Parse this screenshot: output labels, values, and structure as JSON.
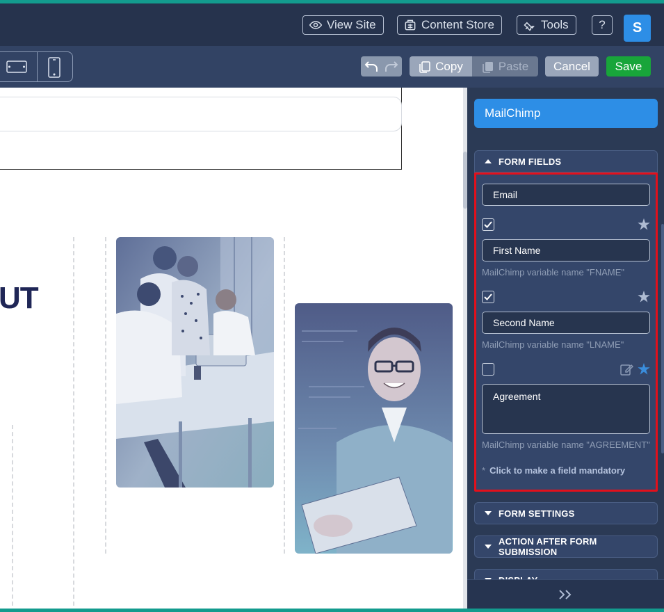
{
  "topbar": {
    "view_site": "View Site",
    "content_store": "Content Store",
    "tools": "Tools",
    "help": "?",
    "avatar_initial": "S"
  },
  "toolbar": {
    "copy": "Copy",
    "paste": "Paste",
    "cancel": "Cancel",
    "save": "Save"
  },
  "canvas": {
    "heading_fragment": "UT"
  },
  "panel": {
    "title": "MailChimp",
    "sections": {
      "form_fields": "FORM FIELDS",
      "form_settings": "FORM SETTINGS",
      "action_after": "ACTION AFTER FORM SUBMISSION",
      "display": "DISPLAY"
    },
    "fields": [
      {
        "label": "Email",
        "checked": null,
        "variable": ""
      },
      {
        "label": "First Name",
        "checked": true,
        "variable": "MailChimp variable name \"FNAME\""
      },
      {
        "label": "Second Name",
        "checked": true,
        "variable": "MailChimp variable name \"LNAME\""
      },
      {
        "label": "Agreement",
        "checked": false,
        "variable": "MailChimp variable name \"AGREEMENT\""
      }
    ],
    "mandatory_note_asterisk": "*",
    "mandatory_note": "Click to make a field mandatory",
    "expand_icon": "»"
  },
  "colors": {
    "accent": "#2d8ee6",
    "save": "#18a53a",
    "highlight": "#e3101b",
    "panel_bg": "#2b3a55"
  }
}
